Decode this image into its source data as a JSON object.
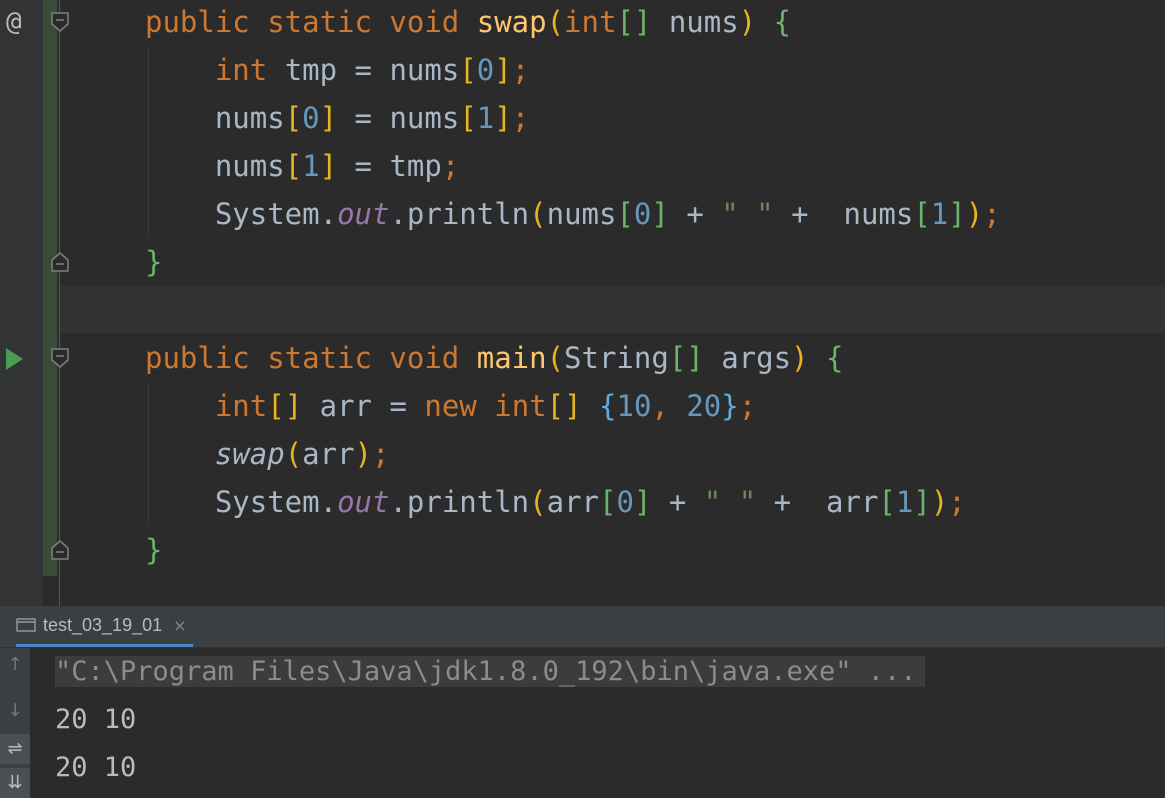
{
  "editor": {
    "gutter": {
      "at_icon": "@",
      "run_icon": "run-triangle-icon"
    },
    "lines": {
      "l1": {
        "kw": "public static void ",
        "fn": "swap",
        "p1": "(",
        "kw2": "int",
        "b": "[]",
        "txt": " nums",
        "p2": ")",
        "sp": " ",
        "brace": "{"
      },
      "l2": {
        "ind": "    ",
        "kw": "int",
        "txt1": " tmp = nums",
        "b1": "[",
        "n": "0",
        "b2": "]",
        "semi": ";"
      },
      "l3": {
        "ind": "    ",
        "txt1": "nums",
        "b1": "[",
        "n1": "0",
        "b2": "]",
        "txt2": " = nums",
        "b3": "[",
        "n2": "1",
        "b4": "]",
        "semi": ";"
      },
      "l4": {
        "ind": "    ",
        "txt1": "nums",
        "b1": "[",
        "n1": "1",
        "b2": "]",
        "txt2": " = tmp",
        "semi": ";"
      },
      "l5": {
        "ind": "    ",
        "txt1": "System.",
        "fld": "out",
        "txt2": ".println",
        "p1": "(",
        "txt3": "nums",
        "b1": "[",
        "n1": "0",
        "b2": "]",
        "txt4": " + ",
        "str": "\" \"",
        "txt5": " +  nums",
        "b3": "[",
        "n2": "1",
        "b4": "]",
        "p2": ")",
        "semi": ";"
      },
      "l6": {
        "brace": "}"
      },
      "l8": {
        "kw": "public static void ",
        "fn": "main",
        "p1": "(",
        "txt": "String",
        "b": "[]",
        "txt2": " args",
        "p2": ")",
        "sp": " ",
        "brace": "{"
      },
      "l9": {
        "ind": "    ",
        "kw": "int",
        "b": "[]",
        "txt": " arr = ",
        "kw2": "new",
        "sp": " ",
        "kw3": "int",
        "b2": "[]",
        "sp2": " ",
        "c1": "{",
        "n1": "10",
        "comma": ", ",
        "n2": "20",
        "c2": "}",
        "semi": ";"
      },
      "l10": {
        "ind": "    ",
        "fn": "swap",
        "p1": "(",
        "txt": "arr",
        "p2": ")",
        "semi": ";"
      },
      "l11": {
        "ind": "    ",
        "txt1": "System.",
        "fld": "out",
        "txt2": ".println",
        "p1": "(",
        "txt3": "arr",
        "b1": "[",
        "n1": "0",
        "b2": "]",
        "txt4": " + ",
        "str": "\" \"",
        "txt5": " +  arr",
        "b3": "[",
        "n2": "1",
        "b4": "]",
        "p2": ")",
        "semi": ";"
      },
      "l12": {
        "brace": "}"
      }
    }
  },
  "run_panel": {
    "tab": {
      "label": "test_03_19_01",
      "close": "×",
      "icon": "console-window-icon"
    },
    "gutter_icons": [
      "↑",
      "↓",
      "⇌",
      "⇊"
    ],
    "console": {
      "command": "\"C:\\Program Files\\Java\\jdk1.8.0_192\\bin\\java.exe\" ...",
      "output": [
        "20 10",
        "20 10"
      ]
    }
  },
  "colors": {
    "keyword": "#cc7832",
    "function": "#ffc66d",
    "number": "#6897bb",
    "string": "#6a8759",
    "field": "#9876aa",
    "text": "#a9b7c6",
    "run_green": "#499c54"
  }
}
